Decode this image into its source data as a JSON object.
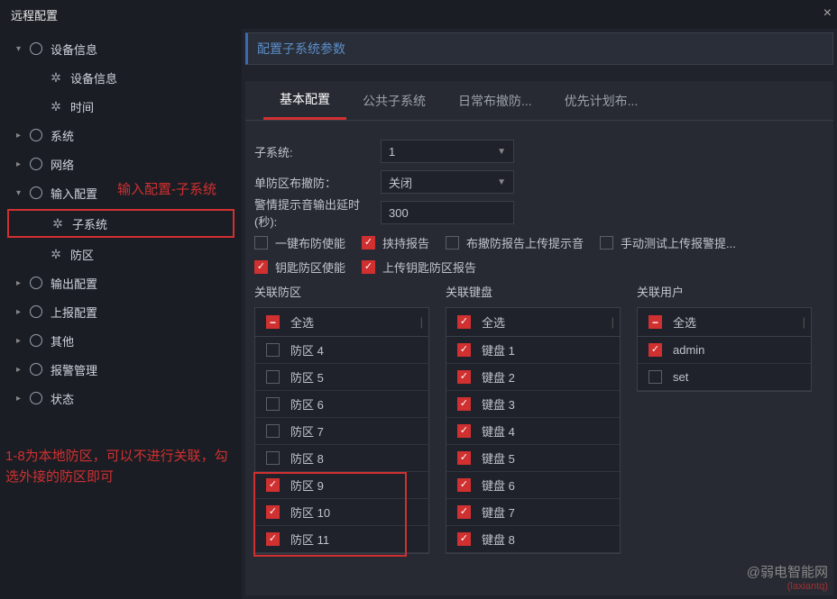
{
  "title": "远程配置",
  "sidebar": {
    "items": [
      {
        "label": "设备信息",
        "caret": "▾",
        "icon": "globe",
        "level": 1
      },
      {
        "label": "设备信息",
        "caret": "",
        "icon": "gear",
        "level": 2
      },
      {
        "label": "时间",
        "caret": "",
        "icon": "gear",
        "level": 2
      },
      {
        "label": "系统",
        "caret": "▸",
        "icon": "globe",
        "level": 1
      },
      {
        "label": "网络",
        "caret": "▸",
        "icon": "globe",
        "level": 1
      },
      {
        "label": "输入配置",
        "caret": "▾",
        "icon": "globe",
        "level": 1
      },
      {
        "label": "子系统",
        "caret": "",
        "icon": "gear",
        "level": 2,
        "boxed": true
      },
      {
        "label": "防区",
        "caret": "",
        "icon": "gear",
        "level": 2
      },
      {
        "label": "输出配置",
        "caret": "▸",
        "icon": "globe",
        "level": 1
      },
      {
        "label": "上报配置",
        "caret": "▸",
        "icon": "globe",
        "level": 1
      },
      {
        "label": "其他",
        "caret": "▸",
        "icon": "globe",
        "level": 1
      },
      {
        "label": "报警管理",
        "caret": "▸",
        "icon": "globe",
        "level": 1
      },
      {
        "label": "状态",
        "caret": "▸",
        "icon": "globe",
        "level": 1
      }
    ]
  },
  "panel_title": "配置子系统参数",
  "tabs": [
    {
      "label": "基本配置",
      "active": true
    },
    {
      "label": "公共子系统",
      "active": false
    },
    {
      "label": "日常布撤防...",
      "active": false
    },
    {
      "label": "优先计划布...",
      "active": false
    }
  ],
  "form": {
    "subsystem_label": "子系统:",
    "subsystem_value": "1",
    "single_zone_label": "单防区布撤防：",
    "single_zone_value": "关闭",
    "alarm_delay_label": "警情提示音输出延时(秒):",
    "alarm_delay_value": "300"
  },
  "checks1": [
    {
      "label": "一键布防使能",
      "checked": false
    },
    {
      "label": "挟持报告",
      "checked": true
    },
    {
      "label": "布撤防报告上传提示音",
      "checked": false
    },
    {
      "label": "手动测试上传报警提...",
      "checked": false
    }
  ],
  "checks2": [
    {
      "label": "钥匙防区使能",
      "checked": true
    },
    {
      "label": "上传钥匙防区报告",
      "checked": true
    }
  ],
  "assoc": {
    "zone_title": "关联防区",
    "keyboard_title": "关联键盘",
    "user_title": "关联用户",
    "all_label": "全选",
    "zones": [
      {
        "label": "防区 4",
        "checked": false
      },
      {
        "label": "防区 5",
        "checked": false
      },
      {
        "label": "防区 6",
        "checked": false
      },
      {
        "label": "防区 7",
        "checked": false
      },
      {
        "label": "防区 8",
        "checked": false
      },
      {
        "label": "防区 9",
        "checked": true
      },
      {
        "label": "防区 10",
        "checked": true
      },
      {
        "label": "防区 11",
        "checked": true
      }
    ],
    "keyboards": [
      {
        "label": "键盘 1",
        "checked": true
      },
      {
        "label": "键盘 2",
        "checked": true
      },
      {
        "label": "键盘 3",
        "checked": true
      },
      {
        "label": "键盘 4",
        "checked": true
      },
      {
        "label": "键盘 5",
        "checked": true
      },
      {
        "label": "键盘 6",
        "checked": true
      },
      {
        "label": "键盘 7",
        "checked": true
      },
      {
        "label": "键盘 8",
        "checked": true
      }
    ],
    "users": [
      {
        "label": "admin",
        "checked": true
      },
      {
        "label": "set",
        "checked": false
      }
    ]
  },
  "annotations": {
    "anno1": "输入配置-子系统",
    "anno2": "1-8为本地防区，可以不进行关联，勾选外接的防区即可"
  },
  "watermark": {
    "line1": "@弱电智能网",
    "line2": "(laxiantq)"
  }
}
